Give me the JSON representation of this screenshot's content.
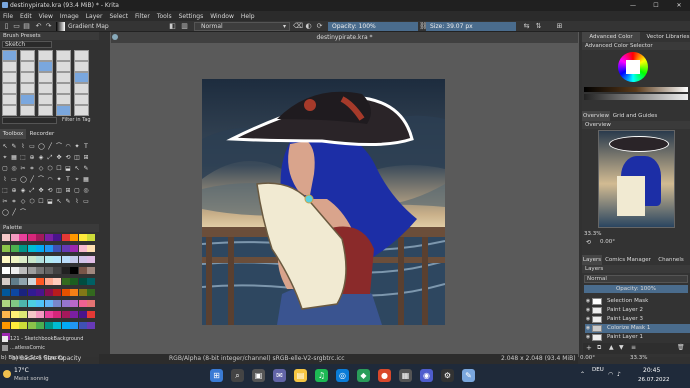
{
  "window": {
    "title": "destinypirate.kra (93.4 MiB)  * - Krita",
    "minimize": "—",
    "maximize": "☐",
    "close": "✕"
  },
  "menu": [
    "File",
    "Edit",
    "View",
    "Image",
    "Layer",
    "Select",
    "Filter",
    "Tools",
    "Settings",
    "Window",
    "Help"
  ],
  "toolbar": {
    "gradient_label": "Gradient Map",
    "blend_mode": "Normal",
    "opacity": "Opacity: 100%",
    "size": "Size: 39.07 px"
  },
  "left": {
    "brush_presets_title": "Brush Presets",
    "brush_tag": "Sketch",
    "filter_label": "Filter in Tag",
    "tab_toolbox": "Toolbox",
    "tab_recorder": "Recorder",
    "palette_title": "Palette",
    "palette_name": "121 - SketchbookBackground",
    "palette_name2": "...atlessComic"
  },
  "document": {
    "tab_title": "destinypirate.kra *"
  },
  "status": {
    "brush": "b) Basic-5 Size Opacity",
    "colorspace": "RGB/Alpha (8-bit integer/channel)  sRGB-elle-V2-srgbtrc.icc",
    "dimensions": "2.048 x 2.048 (93.4 MiB)",
    "rotation": "0.00°",
    "zoom": "33.3%"
  },
  "right": {
    "tab_advanced": "Advanced Color Selec...",
    "tab_vector": "Vector Libraries",
    "advanced_title": "Advanced Color Selector",
    "tab_overview": "Overview",
    "tab_grid": "Grid and Guides",
    "overview_title": "Overview",
    "overview_zoom": "33.3%",
    "overview_rot": "0.00°",
    "tab_layers": "Layers",
    "tab_comics": "Comics Manager",
    "tab_channels": "Channels",
    "layers_title": "Layers",
    "layers_blend": "Normal",
    "layers_opacity": "Opacity: 100%",
    "layers": [
      {
        "name": "Selection Mask"
      },
      {
        "name": "Paint Layer 2"
      },
      {
        "name": "Paint Layer 3"
      },
      {
        "name": "Colorize Mask 1"
      },
      {
        "name": "Paint Layer 1"
      }
    ]
  },
  "taskbar": {
    "weather_temp": "17°C",
    "weather_desc": "Meist sonnig",
    "lang": "DEU",
    "time": "20:45",
    "date": "26.07.2022"
  }
}
